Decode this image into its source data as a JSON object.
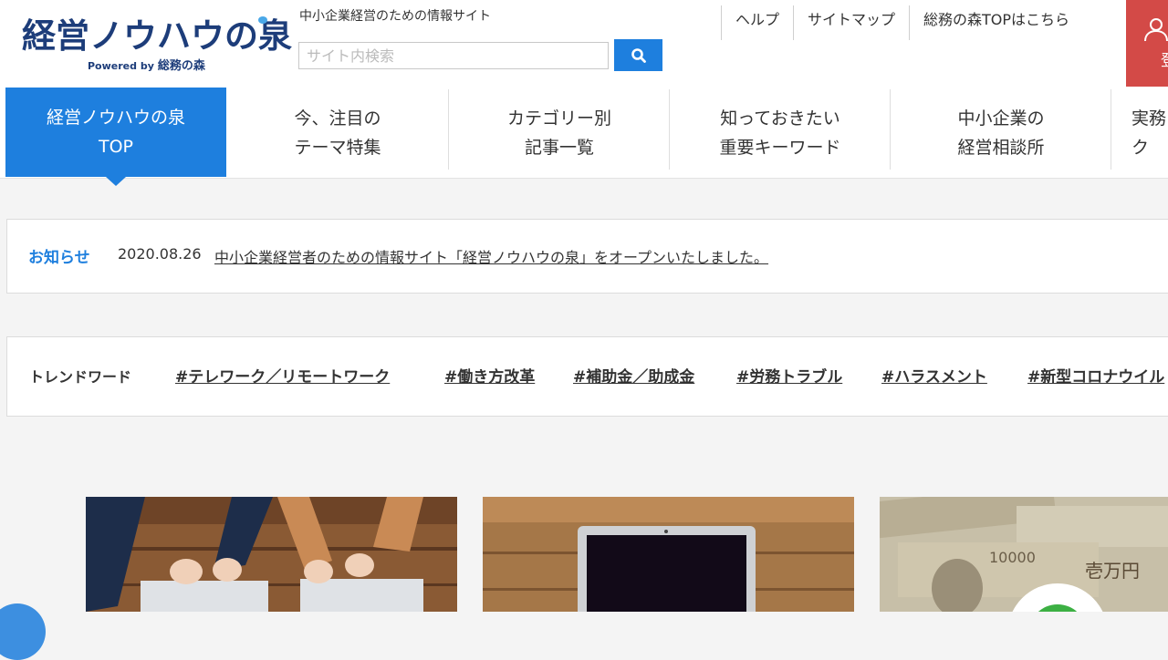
{
  "header": {
    "logo_text": "経営ノウハウの泉",
    "powered_by": "Powered by",
    "powered_brand": "総務の森",
    "tagline": "中小企業経営のための情報サイト",
    "search_placeholder": "サイト内検索",
    "search_icon": "search-icon",
    "util_links": [
      "ヘルプ",
      "サイトマップ",
      "総務の森TOPはこちら"
    ],
    "register_label": "登",
    "register_icon": "user-plus-icon",
    "accent_color": "#1e7fde",
    "register_color": "#d34a47"
  },
  "nav": {
    "items": [
      {
        "label": "経営ノウハウの泉\nTOP",
        "active": true
      },
      {
        "label": "今、注目の\nテーマ特集"
      },
      {
        "label": "カテゴリー別\n記事一覧"
      },
      {
        "label": "知っておきたい\n重要キーワード"
      },
      {
        "label": "中小企業の\n経営相談所"
      },
      {
        "label": "実務\nク"
      }
    ]
  },
  "notice": {
    "label": "お知らせ",
    "date": "2020.08.26",
    "text": "中小企業経営者のための情報サイト「経営ノウハウの泉」をオープンいたしました。"
  },
  "trend": {
    "label": "トレンドワード",
    "tags": [
      "#テレワーク／リモートワーク",
      "#働き方改革",
      "#補助金／助成金",
      "#労務トラブル",
      "#ハラスメント",
      "#新型コロナウイル"
    ]
  },
  "cards": [
    {
      "image": "laptops-on-wooden-desk"
    },
    {
      "image": "laptop-on-wooden-table"
    },
    {
      "image": "yen-banknotes"
    }
  ]
}
